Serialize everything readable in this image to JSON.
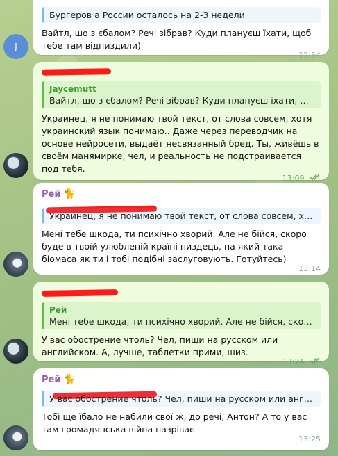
{
  "messages": [
    {
      "quote_text": "Бургеров а России осталось на 2-3 недели",
      "text": "Вайтл, шо з єбалом? Речі зібрав? Куди плануєш їхати, щоб тебе там відпиздили)",
      "time": "12:54",
      "avatar_letter": "J"
    },
    {
      "quote_name": "Jaycemutt",
      "quote_text": "Вайтл, шо з єбалом? Речі зібрав? Куди плануєш їхати, щоб те...",
      "text": "Украинец, я не понимаю твой текст, от слова совсем, хотя украинский язык понимаю.. Даже через переводчик на основе нейросети, выдаёт несвязанный бред. Ты, живёшь в своём манямирке, чел, и реальность не подстраивается под тебя.",
      "time": "13:09"
    },
    {
      "sender": "Рей",
      "sender_emoji": "🐈",
      "quote_text": "Украинец, я не понимаю твой текст, от слова совсем, хотя ук...",
      "text": "Мені тебе шкода, ти психічно хворий. Але не бійся, скоро буде в твоїй улюбленій країні пиздець, на який така біомаса як ти і тобі подібні заслуговують. Готуйтесь)",
      "time": "13:14"
    },
    {
      "quote_name": "Рей",
      "quote_text": "Мені тебе шкода, ти психічно хворий. Але не бійся, скоро буд...",
      "text": "У вас обострение чтоль? Чел, пиши на русском или английском. А, лучше, таблетки прими, шиз.",
      "time": "13:24"
    },
    {
      "sender": "Рей",
      "sender_emoji": "🐈",
      "quote_text": "У вас обострение чтоль? Чел, пиши на русском или английск...",
      "text": "Тобі ще їбало не набили свої ж, до речі, Антон? А то у вас там громадянська війна назріває",
      "time": "13:25"
    }
  ],
  "colors": {
    "incoming_bubble": "#ffffff",
    "outgoing_bubble": "#effdde",
    "redaction": "#ff1a1a",
    "sender_name": "#9b59b6",
    "read_check": "#62ad55"
  }
}
